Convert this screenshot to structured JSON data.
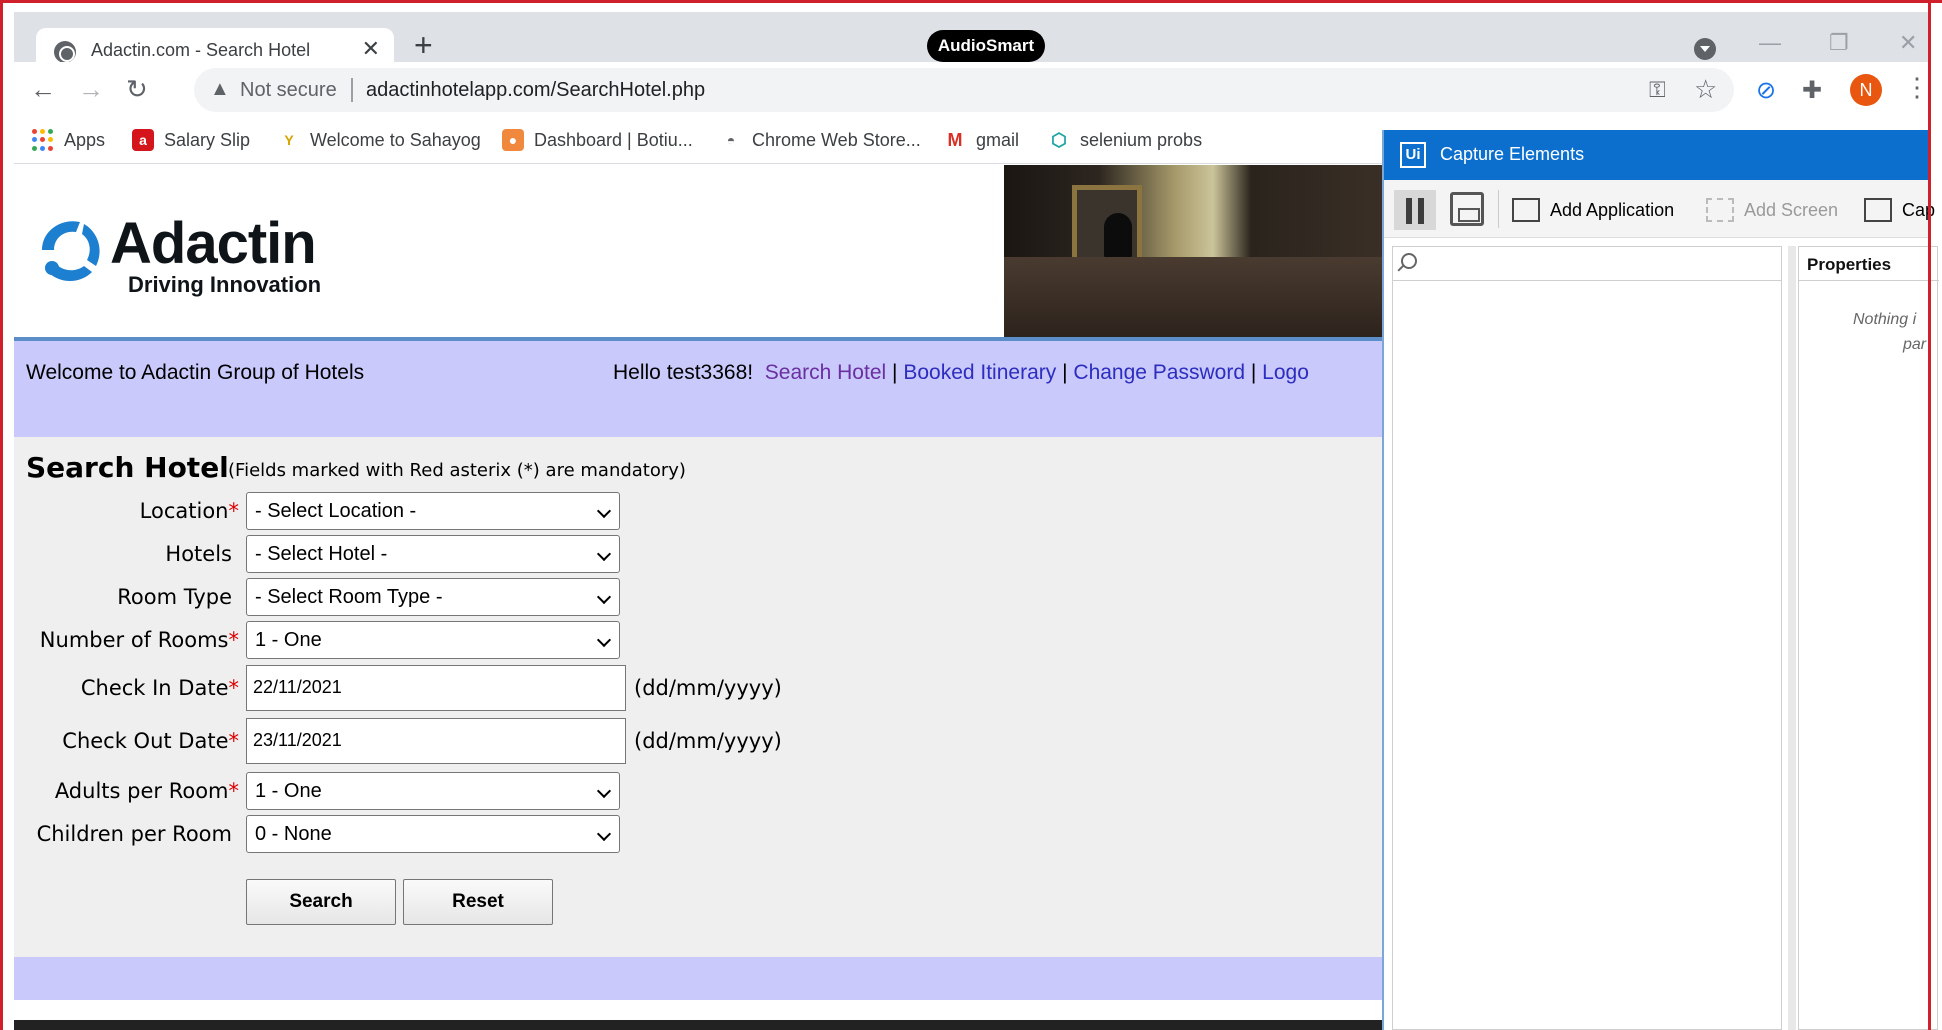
{
  "browser": {
    "tab_title": "Adactin.com - Search Hotel",
    "tab_close": "✕",
    "new_tab": "+",
    "audiosmart_badge": "AudioSmart",
    "security_label": "Not secure",
    "url": "adactinhotelapp.com/SearchHotel.php",
    "avatar_letter": "N",
    "bookmarks": [
      {
        "label": "Apps"
      },
      {
        "label": "Salary Slip"
      },
      {
        "label": "Welcome to Sahayog"
      },
      {
        "label": "Dashboard | Botiu..."
      },
      {
        "label": "Chrome Web Store..."
      },
      {
        "label": "gmail"
      },
      {
        "label": "selenium probs"
      }
    ]
  },
  "site": {
    "logo_name": "Adactin",
    "logo_tagline": "Driving Innovation",
    "welcome": "Welcome to Adactin Group of Hotels",
    "greeting": "Hello test3368!",
    "nav": {
      "search_hotel": "Search Hotel",
      "booked_itinerary": "Booked Itinerary",
      "change_password": "Change Password",
      "logout": "Logo",
      "separator": "|"
    }
  },
  "form": {
    "title": "Search Hotel",
    "note": "(Fields marked with Red asterix (*) are mandatory)",
    "required_mark": "*",
    "fields": {
      "location": {
        "label": "Location",
        "value": "- Select Location -"
      },
      "hotels": {
        "label": "Hotels",
        "value": "- Select Hotel -"
      },
      "room_type": {
        "label": "Room Type",
        "value": "- Select Room Type -"
      },
      "num_rooms": {
        "label": "Number of Rooms",
        "value": "1 - One"
      },
      "check_in": {
        "label": "Check In Date",
        "value": "22/11/2021",
        "hint": "(dd/mm/yyyy)"
      },
      "check_out": {
        "label": "Check Out Date",
        "value": "23/11/2021",
        "hint": "(dd/mm/yyyy)"
      },
      "adults": {
        "label": "Adults per Room",
        "value": "1 - One"
      },
      "children": {
        "label": "Children per Room",
        "value": "0 - None"
      }
    },
    "search_button": "Search",
    "reset_button": "Reset"
  },
  "capture_window": {
    "title": "Capture Elements",
    "logo": "Ui",
    "add_application": "Add Application",
    "add_screen": "Add Screen",
    "capture": "Cap",
    "properties": "Properties",
    "empty_line1": "Nothing i",
    "empty_line2": "par"
  }
}
